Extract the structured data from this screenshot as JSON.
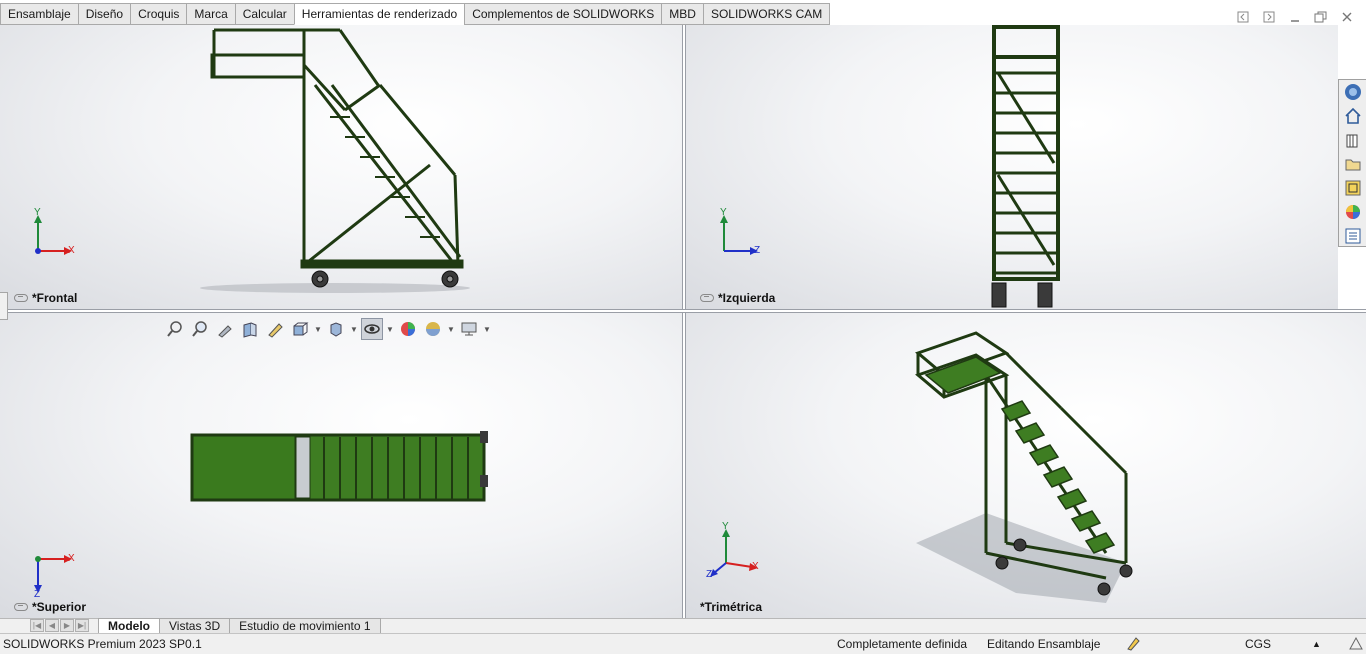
{
  "command_tabs": [
    {
      "label": "Ensamblaje",
      "active": false
    },
    {
      "label": "Diseño",
      "active": false
    },
    {
      "label": "Croquis",
      "active": false
    },
    {
      "label": "Marca",
      "active": false
    },
    {
      "label": "Calcular",
      "active": false
    },
    {
      "label": "Herramientas de renderizado",
      "active": true
    },
    {
      "label": "Complementos de SOLIDWORKS",
      "active": false
    },
    {
      "label": "MBD",
      "active": false
    },
    {
      "label": "SOLIDWORKS CAM",
      "active": false
    }
  ],
  "window_controls": [
    "restore-left-icon",
    "restore-right-icon",
    "minimize-icon",
    "restore-icon",
    "close-icon"
  ],
  "viewports": {
    "front": {
      "label": "*Frontal",
      "axes": [
        "Y",
        "X"
      ]
    },
    "left": {
      "label": "*Izquierda",
      "axes": [
        "Y",
        "Z"
      ]
    },
    "top": {
      "label": "*Superior",
      "axes": [
        "X",
        "Z"
      ]
    },
    "trimetric": {
      "label": "*Trimétrica",
      "axes": [
        "Y",
        "X",
        "Z"
      ]
    }
  },
  "heads_up_toolbar": [
    "zoom-to-fit-icon",
    "zoom-to-area-icon",
    "previous-view-icon",
    "section-view-icon",
    "dynamic-annotation-icon",
    "view-orientation-icon",
    "display-style-icon",
    "hide-show-items-icon",
    "edit-appearance-icon",
    "apply-scene-icon",
    "view-settings-icon"
  ],
  "task_pane": [
    "solidworks-resources-icon",
    "home-icon",
    "design-library-icon",
    "file-explorer-icon",
    "view-palette-icon",
    "appearances-icon",
    "custom-properties-icon"
  ],
  "bottom_tabs": [
    {
      "label": "Modelo",
      "active": true
    },
    {
      "label": "Vistas 3D",
      "active": false
    },
    {
      "label": "Estudio de movimiento 1",
      "active": false
    }
  ],
  "status": {
    "product": "SOLIDWORKS Premium 2023 SP0.1",
    "definition": "Completamente definida",
    "mode": "Editando Ensamblaje",
    "units": "CGS"
  },
  "colors": {
    "frame": "#1f3a12",
    "steps": "#3e7d22",
    "triad_x": "#d62020",
    "triad_y": "#1f8a3a",
    "triad_z": "#2030c8"
  }
}
